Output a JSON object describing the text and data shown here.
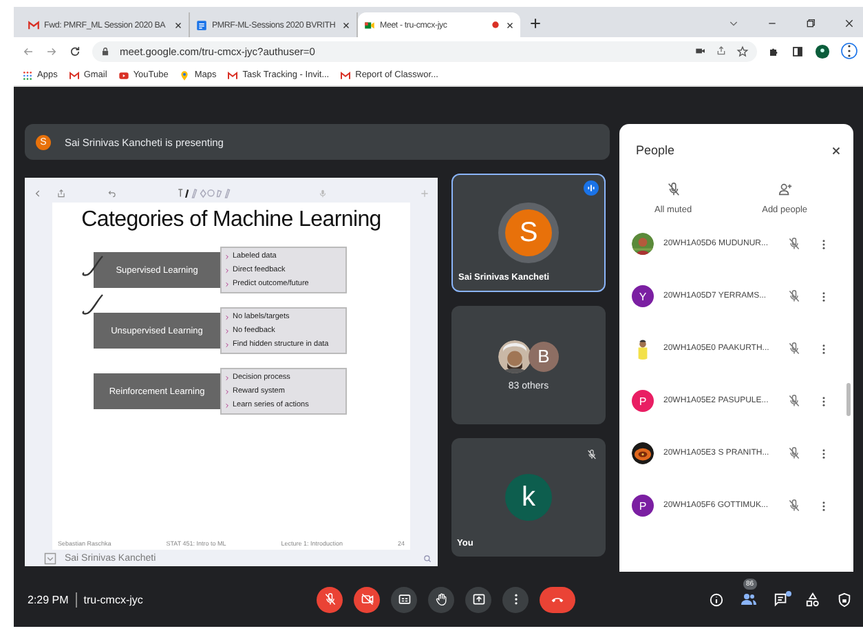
{
  "browser": {
    "tabs": [
      {
        "title": "Fwd: PMRF_ML Session 2020 BA",
        "selected": false,
        "recording": false
      },
      {
        "title": "PMRF-ML-Sessions 2020 BVRITH",
        "selected": false,
        "recording": false
      },
      {
        "title": "Meet - tru-cmcx-jyc",
        "selected": true,
        "recording": true
      }
    ],
    "url": "meet.google.com/tru-cmcx-jyc?authuser=0",
    "bookmarks": [
      {
        "label": "Apps"
      },
      {
        "label": "Gmail"
      },
      {
        "label": "YouTube"
      },
      {
        "label": "Maps"
      },
      {
        "label": "Task Tracking - Invit..."
      },
      {
        "label": "Report of Classwor..."
      }
    ]
  },
  "presenting": {
    "initial": "S",
    "text": "Sai Srinivas Kancheti is presenting"
  },
  "slide": {
    "title": "Categories of Machine Learning",
    "rows": [
      {
        "label": "Supervised Learning",
        "checked": true,
        "items": [
          "Labeled data",
          "Direct feedback",
          "Predict outcome/future"
        ]
      },
      {
        "label": "Unsupervised Learning",
        "checked": true,
        "items": [
          "No labels/targets",
          "No feedback",
          "Find hidden structure in data"
        ]
      },
      {
        "label": "Reinforcement Learning",
        "checked": false,
        "items": [
          "Decision process",
          "Reward system",
          "Learn series of actions"
        ]
      }
    ],
    "footer": [
      "Sebastian Raschka",
      "STAT 451: Intro to ML",
      "Lecture 1: Introduction",
      "24"
    ],
    "presenter_name": "Sai Srinivas Kancheti"
  },
  "tiles": [
    {
      "kind": "speaker",
      "initial": "S",
      "name": "Sai Srinivas Kancheti",
      "speaking": true
    },
    {
      "kind": "group",
      "initial": "B",
      "name": "83 others"
    },
    {
      "kind": "self",
      "initial": "k",
      "name": "You",
      "muted": true
    }
  ],
  "people": {
    "title": "People",
    "actions": [
      {
        "label": "All muted"
      },
      {
        "label": "Add people"
      }
    ],
    "participants": [
      {
        "kind": "picture",
        "name": "20WH1A05D6 MUDUNUR..."
      },
      {
        "kind": "letter",
        "initial": "Y",
        "color": "#7b1fa2",
        "name": "20WH1A05D7 YERRAMS..."
      },
      {
        "kind": "picture",
        "name": "20WH1A05E0 PAAKURTH..."
      },
      {
        "kind": "letter",
        "initial": "P",
        "color": "#e91e63",
        "name": "20WH1A05E2 PASUPULE..."
      },
      {
        "kind": "picture",
        "name": "20WH1A05E3 S PRANITH..."
      },
      {
        "kind": "letter",
        "initial": "P",
        "color": "#7b1fa2",
        "name": "20WH1A05F6 GOTTIMUK..."
      }
    ]
  },
  "bottom_bar": {
    "time": "2:29 PM",
    "meeting_code": "tru-cmcx-jyc",
    "participant_count": "86",
    "chat_unread": true
  }
}
